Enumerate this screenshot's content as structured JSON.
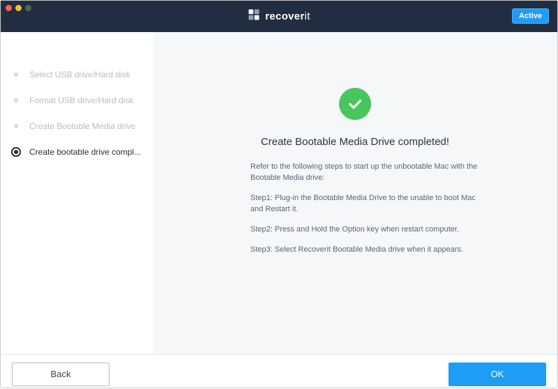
{
  "brand": {
    "name_part1": "recover",
    "name_part2": "it"
  },
  "header": {
    "badge": "Active"
  },
  "sidebar": {
    "items": [
      {
        "label": "Select USB drive/Hard disk",
        "active": false
      },
      {
        "label": "Format USB drive/Hard disk",
        "active": false
      },
      {
        "label": "Create Bootable Media drive",
        "active": false
      },
      {
        "label": "Create bootable drive compl...",
        "active": true
      }
    ]
  },
  "main": {
    "title": "Create Bootable Media Drive completed!",
    "intro": "Refer to the following steps to start up the unbootable Mac with the Bootable Media drive:",
    "step1": "Step1: Plug-in the Bootable Media Drive to the unable to boot Mac and Restart it.",
    "step2": "Step2: Press and Hold the Option key when restart computer.",
    "step3": "Step3: Select Recoverit Bootable Media drive when it appears."
  },
  "footer": {
    "back_label": "Back",
    "ok_label": "OK"
  },
  "icons": {
    "checkmark": "success-check-icon",
    "brand": "wondershare-logo-icon"
  },
  "colors": {
    "header_bg": "#212e42",
    "accent": "#1e9df7",
    "success": "#47c65d"
  }
}
